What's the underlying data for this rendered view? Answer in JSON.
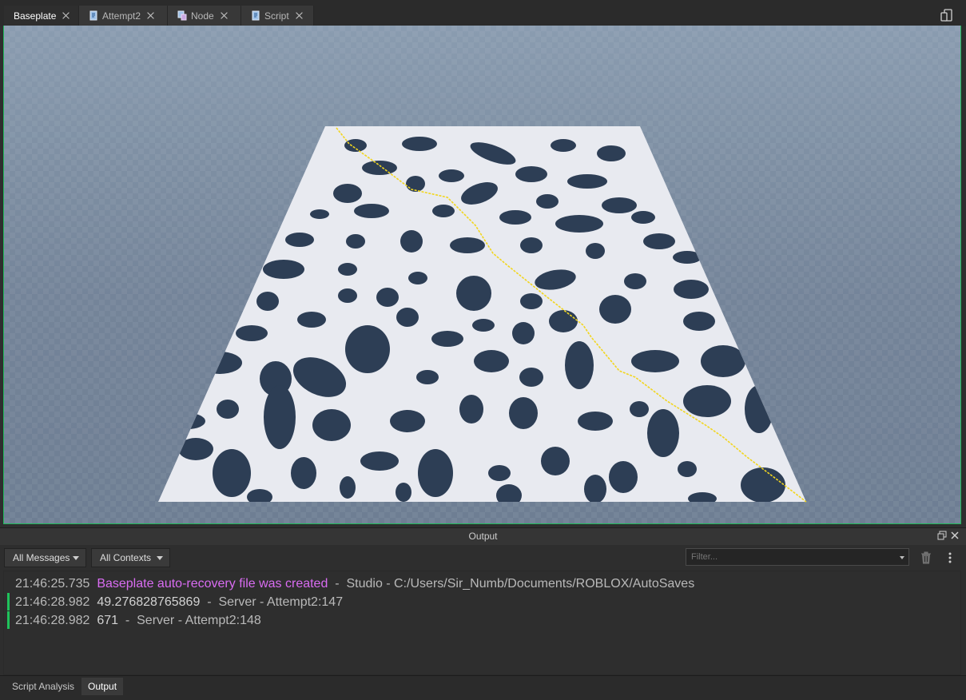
{
  "tabs": [
    {
      "label": "Baseplate",
      "icon": "none",
      "active": true
    },
    {
      "label": "Attempt2",
      "icon": "script-icon",
      "active": false
    },
    {
      "label": "Node",
      "icon": "module-script-icon",
      "active": false
    },
    {
      "label": "Script",
      "icon": "script-icon",
      "active": false
    }
  ],
  "output_panel": {
    "title": "Output",
    "messages_filter": "All Messages",
    "contexts_filter": "All Contexts",
    "filter_placeholder": "Filter..."
  },
  "log": [
    {
      "time": "21:46:25.735",
      "message": "Baseplate auto-recovery file was created",
      "sep": "-",
      "source": "Studio - C:/Users/Sir_Numb/Documents/ROBLOX/AutoSaves",
      "color": "#d96cf2"
    },
    {
      "time": "21:46:28.982",
      "message": "49.276828765869",
      "sep": "-",
      "source": "Server - Attempt2:147",
      "color": "#d2d2d2"
    },
    {
      "time": "21:46:28.982",
      "message": "671",
      "sep": "-",
      "source": "Server - Attempt2:148",
      "color": "#d2d2d2"
    }
  ],
  "bottom_tabs": [
    {
      "label": "Script Analysis",
      "active": false
    },
    {
      "label": "Output",
      "active": true
    }
  ],
  "colors": {
    "accent": "#1fb85a",
    "terrain_white": "#e8eaf0",
    "terrain_dark": "#2d3e55",
    "path": "#f2d61e"
  }
}
